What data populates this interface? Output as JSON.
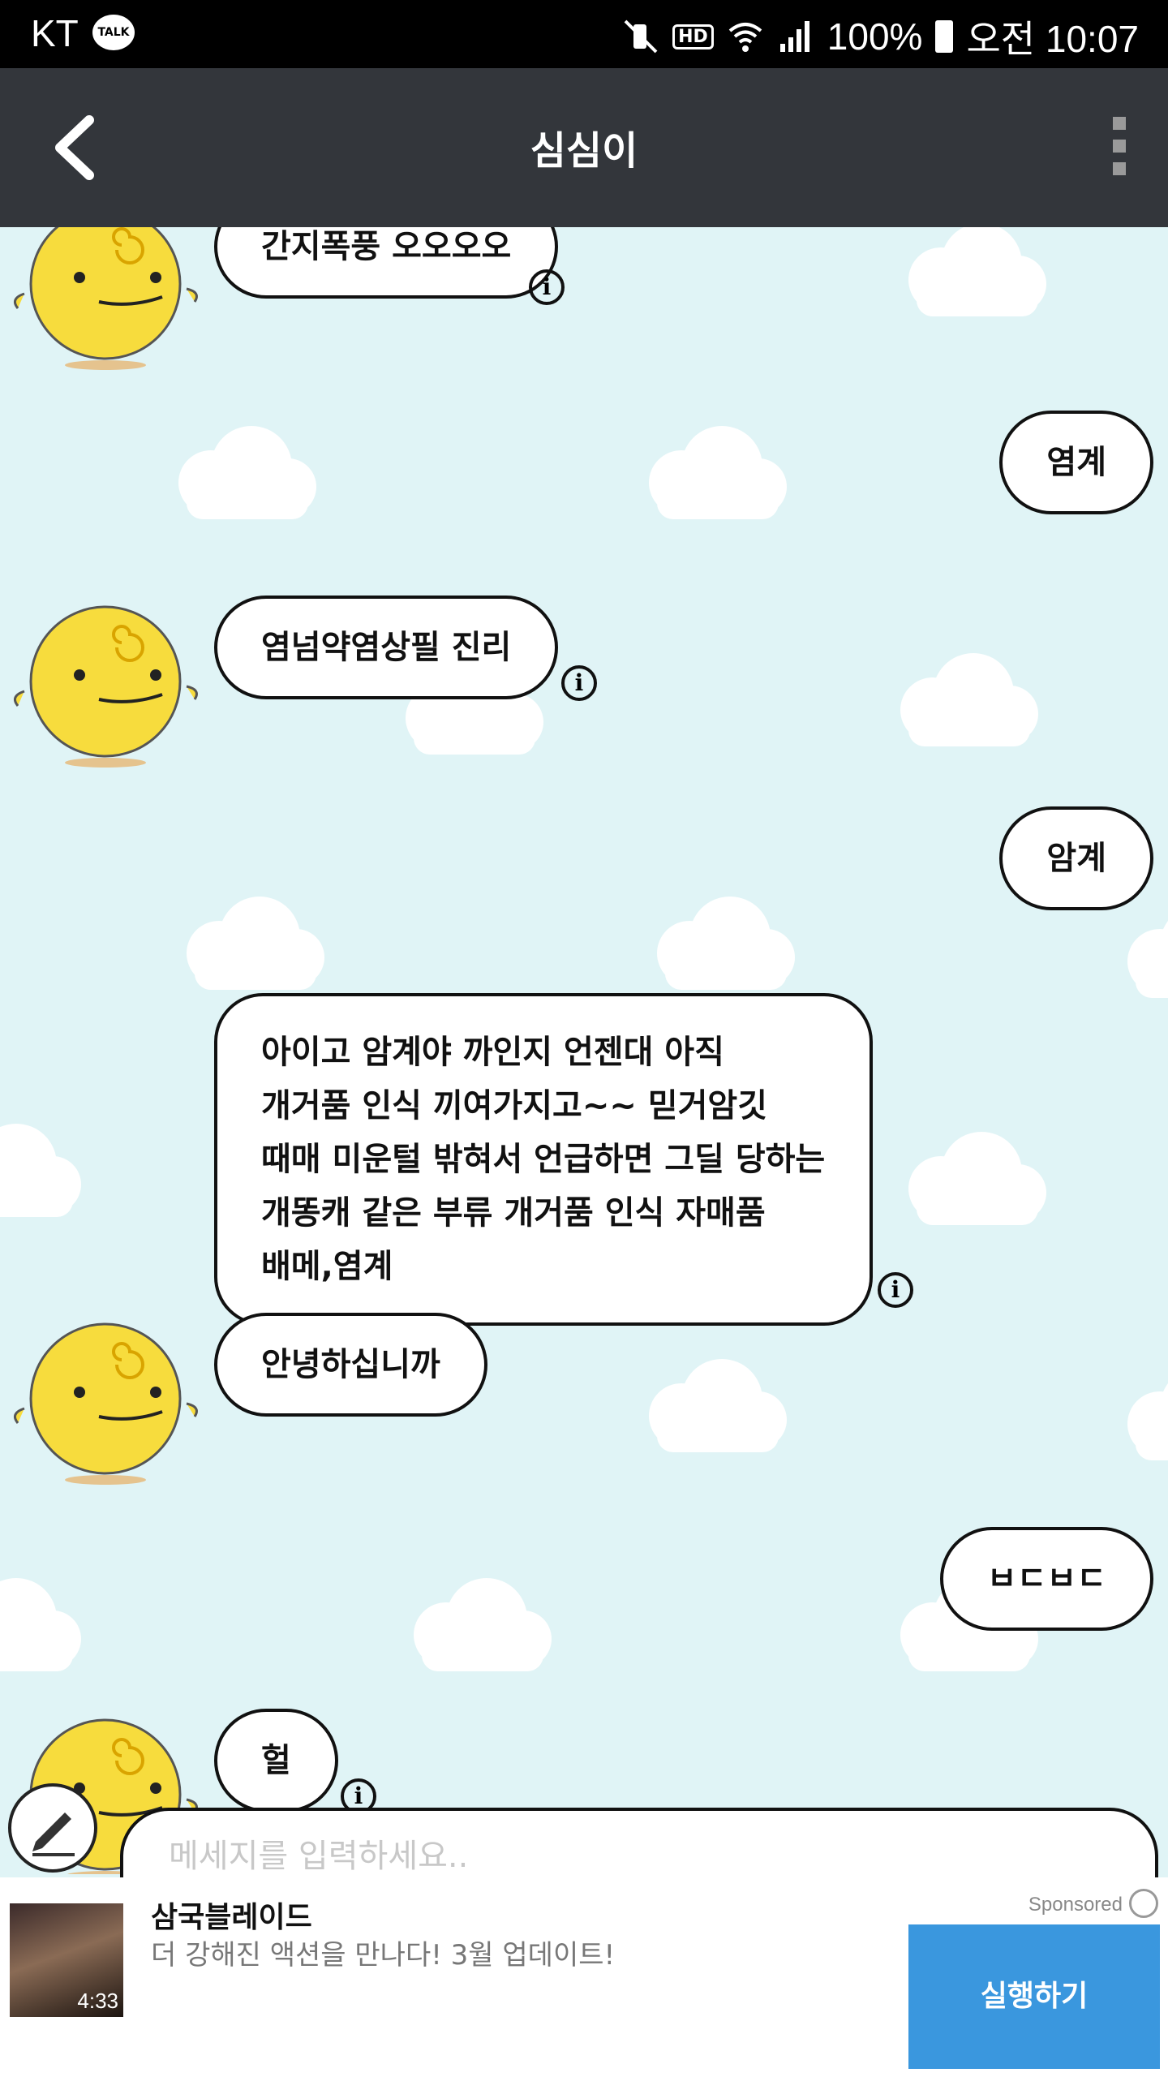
{
  "status_bar": {
    "carrier": "KT",
    "talk_badge": "TALK",
    "hd": "HD",
    "battery": "100%",
    "time": "오전 10:07"
  },
  "app_bar": {
    "title": "심심이"
  },
  "messages": [
    {
      "from": "bot",
      "text": "간지폭풍 오오오오"
    },
    {
      "from": "user",
      "text": "염계"
    },
    {
      "from": "bot",
      "text": "염넘약염상필 진리"
    },
    {
      "from": "user",
      "text": "암계"
    },
    {
      "from": "bot",
      "lines": [
        "아이고 암계야 까인지 언젠대 아직",
        "개거품 인식 끼여가지고~~ 믿거암깃",
        "때매 미운털 밖혀서 언급하면 그딜 당하는",
        "개똥캐 같은 부류 개거품 인식 자매품",
        "배메,염계"
      ]
    },
    {
      "from": "bot",
      "text": "안녕하십니까"
    },
    {
      "from": "user",
      "text": "ㅂㄷㅂㄷ"
    },
    {
      "from": "bot",
      "text": "헐"
    }
  ],
  "info_symbol": "i",
  "input": {
    "placeholder": "메세지를 입력하세요.."
  },
  "ad": {
    "app_name": "삼국블레이드",
    "description": "더 강해진 액션을 만나다! 3월 업데이트!",
    "sponsored": "Sponsored",
    "cta": "실행하기",
    "thumb_duration": "4:33"
  },
  "colors": {
    "status_bar": "#000000",
    "app_bar": "#33363b",
    "chat_bg": "#e0f4f6",
    "cta": "#3a97de",
    "avatar": "#f7dc3d"
  }
}
